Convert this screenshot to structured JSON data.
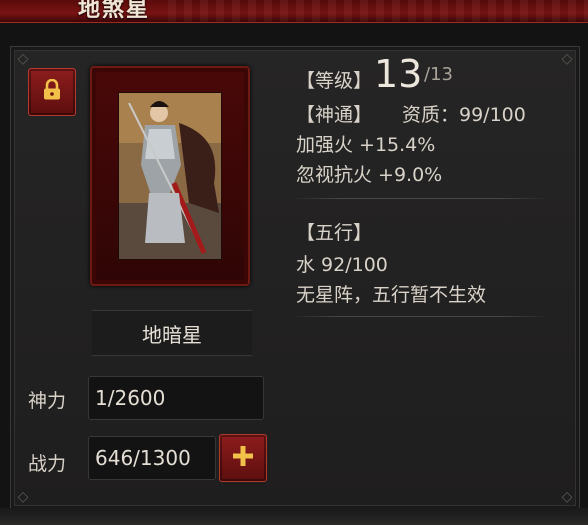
{
  "header": {
    "title": "地煞星"
  },
  "general": {
    "name": "地暗星",
    "level_label": "【等级】",
    "level": "13",
    "level_max": "/13",
    "shentong_label": "【神通】",
    "aptitude": "资质：99/100",
    "bonus_1": "加强火 +15.4%",
    "bonus_2": "忽视抗火 +9.0%",
    "wuxing_label": "【五行】",
    "wuxing_value": "水 92/100",
    "wuxing_note": "无星阵，五行暂不生效"
  },
  "stats": {
    "power_label": "神力",
    "power_value": "1/2600",
    "combat_label": "战力",
    "combat_value": "646/1300"
  },
  "colors": {
    "accent_red": "#8d1d1d",
    "text": "#d8d2c8"
  },
  "icons": {
    "lock": "lock-icon",
    "plus": "plus-icon",
    "portrait": "warrior-portrait"
  }
}
